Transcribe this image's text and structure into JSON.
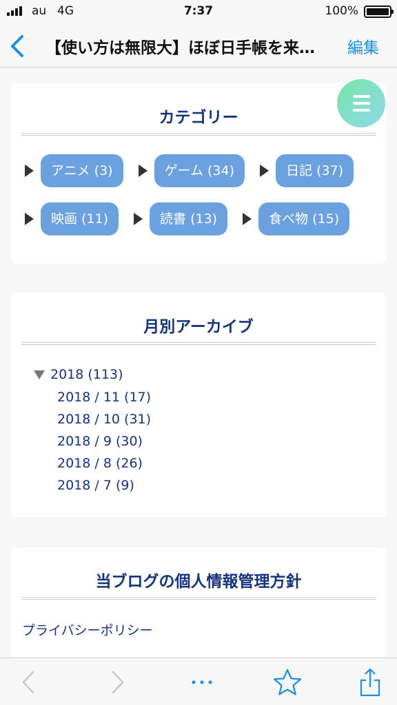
{
  "status_bar": {
    "carrier": "au",
    "network": "4G",
    "time": "7:37",
    "battery_percent": "100%",
    "battery_level": 1.0
  },
  "nav": {
    "title": "【使い方は無限大】ほぼ日手帳を来…",
    "edit_label": "編集"
  },
  "categories": {
    "title": "カテゴリー",
    "items": [
      {
        "label": "アニメ (3)"
      },
      {
        "label": "ゲーム (34)"
      },
      {
        "label": "日記 (37)"
      },
      {
        "label": "映画 (11)"
      },
      {
        "label": "読書 (13)"
      },
      {
        "label": "食べ物 (15)"
      }
    ]
  },
  "archive": {
    "title": "月別アーカイブ",
    "year_label": "2018 (113)",
    "months": [
      "2018 / 11 (17)",
      "2018 / 10 (31)",
      "2018 / 9 (30)",
      "2018 / 8 (26)",
      "2018 / 7 (9)"
    ]
  },
  "privacy": {
    "title": "当ブログの個人情報管理方針",
    "link": "プライバシーポリシー"
  },
  "colors": {
    "accent": "#1a8fe0",
    "chip": "#6aa1de",
    "heading": "#16327a",
    "fab_start": "#78e6a8",
    "fab_end": "#8fd7ea"
  },
  "icons": [
    "back-chevron-icon",
    "hamburger-menu-icon",
    "back-arrow-icon",
    "forward-arrow-icon",
    "more-dots-icon",
    "bookmark-star-icon",
    "share-icon"
  ]
}
